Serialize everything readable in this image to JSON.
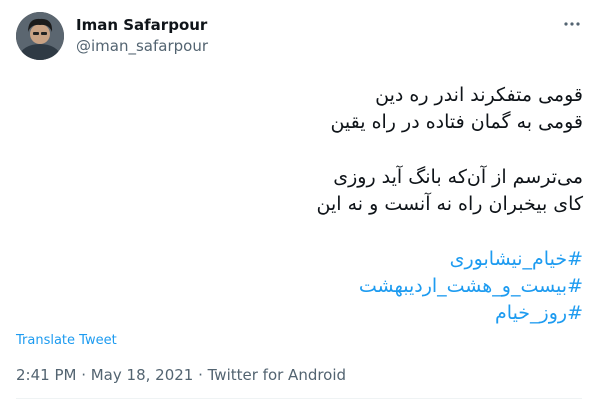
{
  "author": {
    "name": "Iman Safarpour",
    "handle": "@iman_safarpour"
  },
  "tweet": {
    "lines": [
      "قومی متفکرند اندر ره دین",
      "قومی به گمان فتاده در راه یقین",
      "می‌ترسم از آن‌که بانگ آید روزی",
      "کای بیخبران راه نه آنست و نه این"
    ],
    "hashtags": [
      "#خیام_نیشابوری",
      "#بیست_و_هشت_اردیبهشت",
      "#روز_خیام"
    ]
  },
  "translate_label": "Translate Tweet",
  "meta": "2:41 PM · May 18, 2021 · Twitter for Android",
  "colors": {
    "link": "#1d9bf0",
    "secondary": "#536471",
    "text": "#0f1419"
  },
  "icons": {
    "more": "more-horizontal-icon"
  }
}
